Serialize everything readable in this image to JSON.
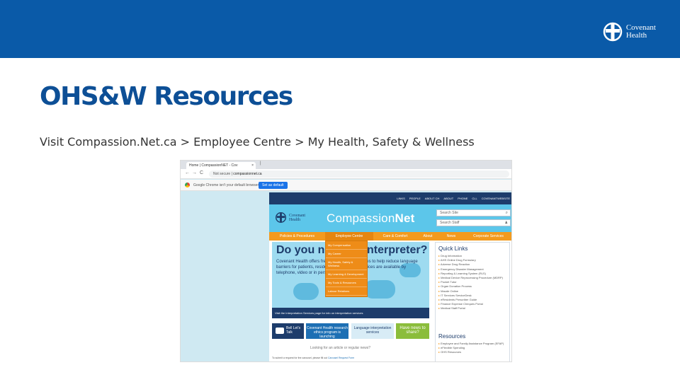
{
  "slide": {
    "brand": {
      "line1": "Covenant",
      "line2": "Health"
    },
    "title": "OHS&W Resources",
    "subtitle": "Visit Compassion.Net.ca > Employee Centre > My Health, Safety & Wellness",
    "colors": {
      "header_bg": "#0a5aa8",
      "title": "#0d4f96"
    }
  },
  "browser": {
    "tab_title": "Home | CompassionNET - Cov",
    "tab_close": "×",
    "new_tab": "|",
    "back": "←",
    "forward": "→",
    "reload": "C",
    "url_security": "Not secure",
    "url": "compassionnet.ca",
    "infobar_text": "Google Chrome isn't your default browser",
    "infobar_button": "Set as default"
  },
  "site": {
    "toplinks": [
      "LINKS",
      "PEOPLE",
      "ABOUT CH",
      "ABOUT",
      "PHONE",
      "CLL",
      "COVENANTWEBSITE"
    ],
    "logo": {
      "line1": "Covenant",
      "line2": "Health"
    },
    "name_prefix": "Compassion",
    "name_suffix": "Net",
    "search_placeholder": "Search Site",
    "scope_value": "Search Staff",
    "search_icon": "search-icon",
    "nav": [
      "Policies & Procedures",
      "Employee Centre",
      "Care & Comfort",
      "About",
      "News",
      "Corporate Services"
    ],
    "dropdown": [
      "My Compensation",
      "My Career",
      "My Health, Safety & Wellness",
      "My Learning & Development",
      "My Tools & Resources",
      "Labour Relations"
    ],
    "hero": {
      "title": "Do you need an interpreter?",
      "body": "Covenant Health offers free interpretation services to help reduce language barriers for patients, residents and families. Services are available by telephone, video or in person.",
      "caption": "Visit the Interpretation Services page for info on interpretation services"
    },
    "promos": {
      "bell": "Bell Let's Talk",
      "covenant": "Covenant Health research ethics program is launching",
      "language": "Language interpretation services",
      "voice": "Have news to share?"
    },
    "looking": "Looking for an article or regular news?",
    "footnote_text": "To submit a request for the carousel, please fill out ",
    "footnote_link": "Carousel Request Form",
    "quick_links": {
      "title": "Quick Links",
      "items": [
        "Drug Information",
        "AHS Online Drug Formulary",
        "Adverse Drug Reaction",
        "Emergency Disaster Management",
        "Reporting & Learning System (RLS)",
        "Medical Device Reprocessing Procedure (MDRP)",
        "Pocket Tutor",
        "Organ Donation Process",
        "Maude Online",
        "IT Services ServiceDesk",
        "eResidents Prescriber Guide",
        "Finance Expense Cheques Portal",
        "Medical Staff Portal"
      ]
    },
    "resources": {
      "title": "Resources",
      "items": [
        "Employee and Family Assistance Program (EFAP)",
        "eFlexible Spending",
        "OHS Resources"
      ]
    }
  }
}
